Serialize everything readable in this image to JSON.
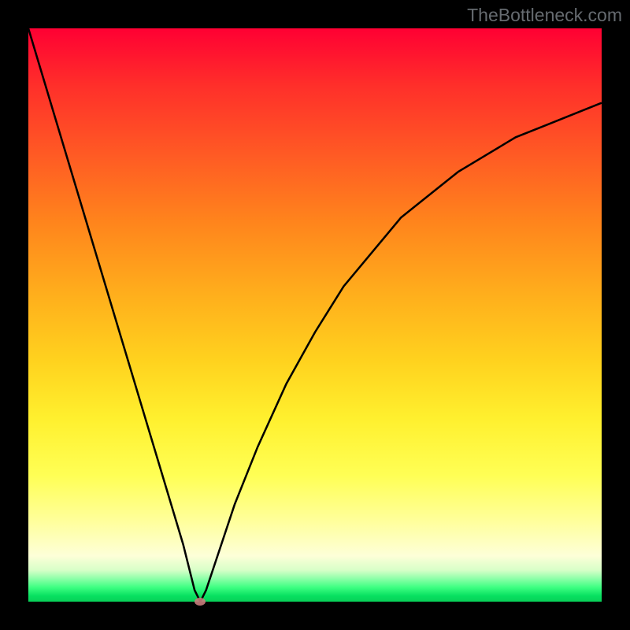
{
  "watermark": "TheBottleneck.com",
  "colors": {
    "curve": "#000000",
    "point": "#c97c7c",
    "frame": "#000000"
  },
  "chart_data": {
    "type": "line",
    "title": "",
    "xlabel": "",
    "ylabel": "",
    "xlim": [
      0,
      100
    ],
    "ylim": [
      0,
      100
    ],
    "series": [
      {
        "name": "curve",
        "x": [
          0,
          3,
          6,
          9,
          12,
          15,
          18,
          21,
          24,
          27,
          29,
          30,
          31,
          33,
          36,
          40,
          45,
          50,
          55,
          60,
          65,
          70,
          75,
          80,
          85,
          90,
          95,
          100
        ],
        "y": [
          100,
          90,
          80,
          70,
          60,
          50,
          40,
          30,
          20,
          10,
          2,
          0,
          2,
          8,
          17,
          27,
          38,
          47,
          55,
          61,
          67,
          71,
          75,
          78,
          81,
          83,
          85,
          87
        ]
      }
    ],
    "annotations": [
      {
        "name": "min-point",
        "x": 30,
        "y": 0
      }
    ],
    "grid": false,
    "legend": false
  }
}
